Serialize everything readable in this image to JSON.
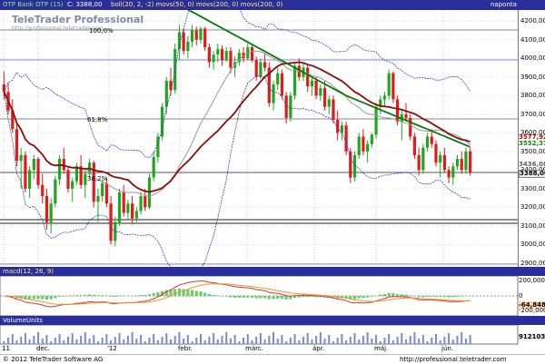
{
  "title_bar": {
    "symbol_text": "OTP Bank OTP (15)",
    "close_text": "C: 3388,00",
    "indicators_text": "boll(20, 2, -2) movs(50, 0) movs(200, 0) movs(200, 0)",
    "period_label": "naponta"
  },
  "watermark": {
    "name": "TeleTrader Professional",
    "url": "http://professional.teletrader.com"
  },
  "price_axis": {
    "ticks": [
      "4200,00",
      "4100,00",
      "4000,00",
      "3900,00",
      "3800,00",
      "3700,00",
      "3600,00",
      "3500,00",
      "3400,00",
      "3300,00",
      "3200,00",
      "3100,00",
      "3000,00",
      "2900,00"
    ],
    "ylim": [
      2880,
      4260
    ]
  },
  "price_tags": [
    {
      "text": "3577,92",
      "color": "#b00000"
    },
    {
      "text": "3552,37",
      "color": "#0a8a0a"
    },
    {
      "text": "3436,08",
      "color": "#606060"
    },
    {
      "text": "3388,00",
      "color": "#000000"
    }
  ],
  "fib_labels": [
    {
      "text": "100,0%",
      "value": 4180
    },
    {
      "text": "61,8%",
      "value": 3690
    },
    {
      "text": "38,2%",
      "value": 3440
    }
  ],
  "macd": {
    "label": "macd(12, 26, 9)",
    "axis_ticks": [
      "200,0000",
      "0",
      "-200,0000"
    ],
    "value_tag": "-64,8482"
  },
  "volume": {
    "label": "VolumeUnits",
    "value_tag": "912103"
  },
  "x_axis": {
    "labels": [
      "11",
      "dec.",
      "'12",
      "febr.",
      "márc.",
      "ápr.",
      "máj.",
      "jún."
    ]
  },
  "footer": {
    "copyright": "© 2012 TeleTrader Software AG",
    "url": "http://professional.teletrader.com"
  },
  "colors": {
    "header_bg": "#2a2e9a",
    "up_candle": "#1fa81f",
    "down_candle": "#e01b1b",
    "ma50": "#8b0c0c",
    "ma200": "#0a7a0a",
    "bollinger": "#3c3cc0"
  },
  "chart_data": {
    "type": "candlestick",
    "ylim": [
      2880,
      4260
    ],
    "candles": [
      [
        3860,
        3930,
        3780,
        3820
      ],
      [
        3820,
        3870,
        3700,
        3720
      ],
      [
        3720,
        3780,
        3600,
        3620
      ],
      [
        3620,
        3660,
        3420,
        3450
      ],
      [
        3450,
        3520,
        3300,
        3480
      ],
      [
        3480,
        3500,
        3280,
        3300
      ],
      [
        3300,
        3420,
        3250,
        3400
      ],
      [
        3400,
        3480,
        3350,
        3460
      ],
      [
        3460,
        3470,
        3300,
        3320
      ],
      [
        3320,
        3380,
        3220,
        3260
      ],
      [
        3260,
        3300,
        3080,
        3120
      ],
      [
        3120,
        3250,
        3060,
        3220
      ],
      [
        3220,
        3370,
        3200,
        3350
      ],
      [
        3350,
        3480,
        3320,
        3460
      ],
      [
        3460,
        3520,
        3380,
        3400
      ],
      [
        3400,
        3420,
        3280,
        3300
      ],
      [
        3300,
        3360,
        3230,
        3340
      ],
      [
        3340,
        3440,
        3320,
        3420
      ],
      [
        3420,
        3480,
        3300,
        3320
      ],
      [
        3320,
        3400,
        3250,
        3380
      ],
      [
        3380,
        3460,
        3360,
        3440
      ],
      [
        3440,
        3450,
        3200,
        3230
      ],
      [
        3230,
        3300,
        3120,
        3260
      ],
      [
        3260,
        3350,
        3230,
        3330
      ],
      [
        3330,
        3360,
        3200,
        3220
      ],
      [
        3220,
        3260,
        3000,
        3020
      ],
      [
        3020,
        3150,
        2990,
        3120
      ],
      [
        3120,
        3300,
        3100,
        3280
      ],
      [
        3280,
        3320,
        3150,
        3170
      ],
      [
        3170,
        3240,
        3130,
        3220
      ],
      [
        3220,
        3260,
        3110,
        3140
      ],
      [
        3140,
        3200,
        3120,
        3180
      ],
      [
        3180,
        3280,
        3160,
        3260
      ],
      [
        3260,
        3300,
        3180,
        3200
      ],
      [
        3200,
        3380,
        3190,
        3360
      ],
      [
        3360,
        3500,
        3340,
        3470
      ],
      [
        3470,
        3600,
        3440,
        3580
      ],
      [
        3580,
        3760,
        3560,
        3740
      ],
      [
        3740,
        3900,
        3700,
        3880
      ],
      [
        3880,
        3950,
        3800,
        3830
      ],
      [
        3830,
        4080,
        3810,
        4050
      ],
      [
        4050,
        4180,
        3990,
        4140
      ],
      [
        4140,
        4160,
        4020,
        4040
      ],
      [
        4040,
        4120,
        4000,
        4090
      ],
      [
        4090,
        4180,
        4060,
        4150
      ],
      [
        4150,
        4170,
        4070,
        4100
      ],
      [
        4100,
        4170,
        4080,
        4160
      ],
      [
        4160,
        4170,
        4040,
        4060
      ],
      [
        4060,
        4080,
        3950,
        3980
      ],
      [
        3980,
        4040,
        3940,
        4020
      ],
      [
        4020,
        4080,
        3980,
        4050
      ],
      [
        4050,
        4070,
        3960,
        3990
      ],
      [
        3990,
        4060,
        3980,
        4040
      ],
      [
        4040,
        4060,
        3920,
        3950
      ],
      [
        3950,
        4010,
        3900,
        3980
      ],
      [
        3980,
        4050,
        3960,
        4030
      ],
      [
        4030,
        4060,
        3980,
        4000
      ],
      [
        4000,
        4080,
        3990,
        4060
      ],
      [
        4060,
        4070,
        3980,
        3990
      ],
      [
        3990,
        4010,
        3880,
        3900
      ],
      [
        3900,
        4000,
        3890,
        3980
      ],
      [
        3980,
        4030,
        3930,
        3950
      ],
      [
        3950,
        3980,
        3740,
        3760
      ],
      [
        3760,
        3880,
        3720,
        3860
      ],
      [
        3860,
        3950,
        3830,
        3920
      ],
      [
        3920,
        3940,
        3780,
        3800
      ],
      [
        3800,
        3820,
        3650,
        3680
      ],
      [
        3680,
        3820,
        3660,
        3800
      ],
      [
        3800,
        3980,
        3780,
        3960
      ],
      [
        3960,
        4000,
        3880,
        3900
      ],
      [
        3900,
        3980,
        3880,
        3950
      ],
      [
        3950,
        3970,
        3820,
        3850
      ],
      [
        3850,
        3900,
        3800,
        3880
      ],
      [
        3880,
        3900,
        3780,
        3800
      ],
      [
        3800,
        3860,
        3770,
        3840
      ],
      [
        3840,
        3880,
        3720,
        3740
      ],
      [
        3740,
        3800,
        3700,
        3780
      ],
      [
        3780,
        3800,
        3650,
        3670
      ],
      [
        3670,
        3720,
        3560,
        3600
      ],
      [
        3600,
        3660,
        3560,
        3640
      ],
      [
        3640,
        3660,
        3480,
        3500
      ],
      [
        3500,
        3520,
        3330,
        3360
      ],
      [
        3360,
        3500,
        3340,
        3480
      ],
      [
        3480,
        3600,
        3460,
        3580
      ],
      [
        3580,
        3620,
        3480,
        3500
      ],
      [
        3500,
        3560,
        3440,
        3540
      ],
      [
        3540,
        3600,
        3520,
        3590
      ],
      [
        3590,
        3760,
        3570,
        3740
      ],
      [
        3740,
        3800,
        3700,
        3780
      ],
      [
        3780,
        3820,
        3740,
        3800
      ],
      [
        3800,
        3940,
        3780,
        3920
      ],
      [
        3920,
        3930,
        3760,
        3780
      ],
      [
        3780,
        3800,
        3640,
        3660
      ],
      [
        3660,
        3720,
        3560,
        3700
      ],
      [
        3700,
        3760,
        3660,
        3680
      ],
      [
        3680,
        3700,
        3560,
        3580
      ],
      [
        3580,
        3600,
        3460,
        3480
      ],
      [
        3480,
        3520,
        3370,
        3400
      ],
      [
        3400,
        3540,
        3380,
        3520
      ],
      [
        3520,
        3600,
        3500,
        3580
      ],
      [
        3580,
        3620,
        3520,
        3540
      ],
      [
        3540,
        3560,
        3420,
        3440
      ],
      [
        3440,
        3500,
        3360,
        3480
      ],
      [
        3480,
        3520,
        3390,
        3400
      ],
      [
        3400,
        3420,
        3330,
        3360
      ],
      [
        3360,
        3440,
        3320,
        3420
      ],
      [
        3420,
        3480,
        3400,
        3460
      ],
      [
        3460,
        3500,
        3380,
        3400
      ],
      [
        3400,
        3520,
        3380,
        3500
      ],
      [
        3500,
        3520,
        3370,
        3388
      ]
    ]
  }
}
